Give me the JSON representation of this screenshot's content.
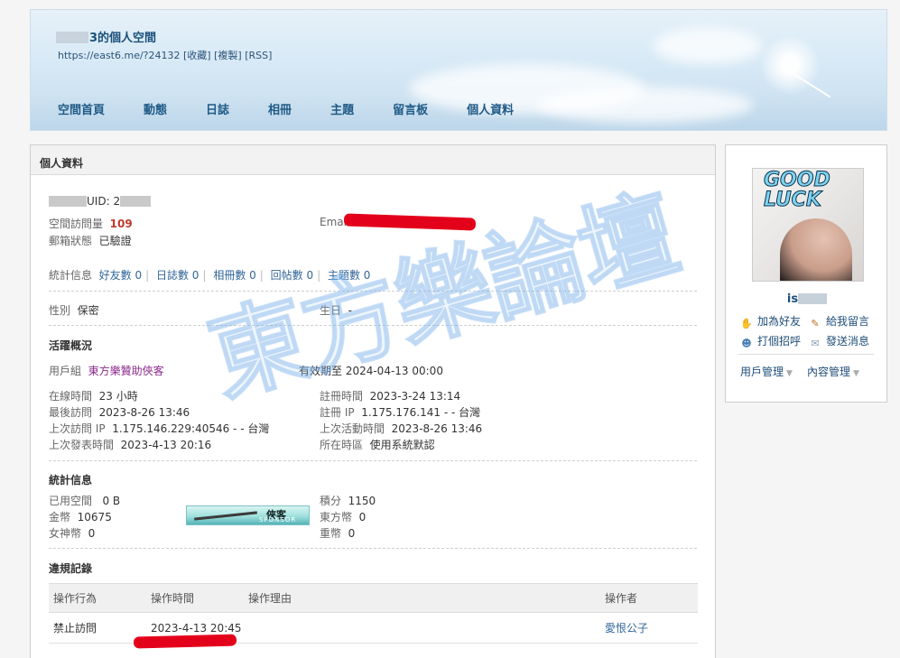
{
  "header": {
    "title_visible": "3的個人空間",
    "url": "https://east6.me/?24132",
    "links": [
      "[收藏]",
      "[複製]",
      "[RSS]"
    ],
    "nav": [
      "空間首頁",
      "動態",
      "日誌",
      "相冊",
      "主題",
      "留言板",
      "個人資料"
    ]
  },
  "panel": {
    "title": "個人資料"
  },
  "profile": {
    "uid_label": "UID:",
    "uid_value": "2",
    "visits_label": "空間訪問量",
    "visits_value": "109",
    "email_label": "Email",
    "mail_status_label": "郵箱狀態",
    "mail_status_value": "已驗證",
    "stats_label": "統計信息",
    "stats": [
      "好友數 0",
      "日誌數 0",
      "相冊數 0",
      "回帖數 0",
      "主題數 0"
    ],
    "gender_label": "性別",
    "gender_value": "保密",
    "birthday_label": "生日",
    "birthday_value": "-"
  },
  "activity": {
    "title": "活躍概況",
    "group_label": "用戶組",
    "group_value": "東方樂贊助俠客",
    "sponsor_badge_name": "俠客",
    "sponsor_badge_tag": "SPONSOR",
    "expire_text": "有效期至 2024-04-13 00:00",
    "online_label": "在線時間",
    "online_value": "23 小時",
    "register_label": "註冊時間",
    "register_value": "2023-3-24 13:14",
    "last_visit_label": "最後訪問",
    "last_visit_value": "2023-8-26 13:46",
    "register_ip_label": "註冊 IP",
    "register_ip_value": "1.175.176.141 - - 台灣",
    "last_ip_label": "上次訪問 IP",
    "last_ip_value": "1.175.146.229:40546 - - 台灣",
    "last_active_label": "上次活動時間",
    "last_active_value": "2023-8-26 13:46",
    "last_post_label": "上次發表時間",
    "last_post_value": "2023-4-13 20:16",
    "timezone_label": "所在時區",
    "timezone_value": "使用系統默認"
  },
  "stats_info": {
    "title": "統計信息",
    "used_space_label": "已用空間",
    "used_space_value": "0 B",
    "points_label": "積分",
    "points_value": "1150",
    "gold_label": "金幣",
    "gold_value": "10675",
    "east_label": "東方幣",
    "east_value": "0",
    "goddess_label": "女神幣",
    "goddess_value": "0",
    "heavy_label": "重幣",
    "heavy_value": "0"
  },
  "violations": {
    "title": "違規記錄",
    "headers": [
      "操作行為",
      "操作時間",
      "操作理由",
      "操作者"
    ],
    "rows": [
      {
        "action": "禁止訪問",
        "time": "2023-4-13 20:45",
        "reason": "",
        "operator": "愛恨公子"
      }
    ]
  },
  "watermark": "東方樂論壇",
  "sidebar": {
    "avatar_text_line1": "GOOD",
    "avatar_text_line2": "LUCK",
    "username_visible": "is",
    "actions": [
      "加為好友",
      "給我留言",
      "打個招呼",
      "發送消息"
    ],
    "menus": [
      "用戶管理",
      "內容管理"
    ]
  },
  "colors": {
    "accent": "#1f5a86",
    "redact": "#e3001b",
    "group": "#8b2b8b"
  }
}
